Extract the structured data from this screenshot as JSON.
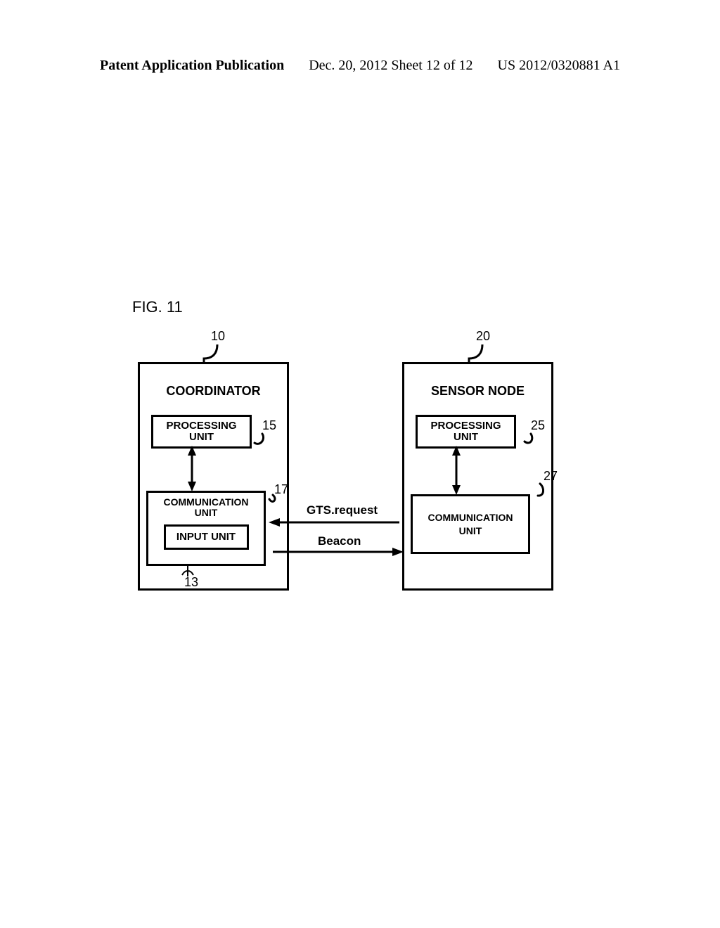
{
  "header": {
    "left": "Patent Application Publication",
    "mid": "Dec. 20, 2012  Sheet 12 of 12",
    "right": "US 2012/0320881 A1"
  },
  "figure": {
    "label": "FIG. 11"
  },
  "coordinator": {
    "title": "COORDINATOR",
    "ref": "10",
    "processing": {
      "label": "PROCESSING UNIT",
      "ref": "15"
    },
    "communication": {
      "label": "COMMUNICATION UNIT",
      "ref": "17"
    },
    "input": {
      "label": "INPUT UNIT",
      "ref": "13"
    }
  },
  "sensor": {
    "title": "SENSOR NODE",
    "ref": "20",
    "processing": {
      "label": "PROCESSING UNIT",
      "ref": "25"
    },
    "communication": {
      "label": "COMMUNICATION UNIT",
      "ref": "27"
    }
  },
  "messages": {
    "request": "GTS.request",
    "beacon": "Beacon"
  }
}
